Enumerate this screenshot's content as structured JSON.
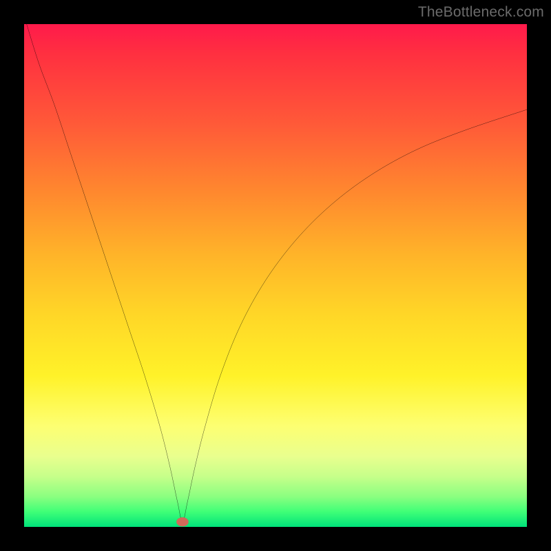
{
  "watermark": "TheBottleneck.com",
  "colors": {
    "frame": "#000000",
    "curve": "#000000",
    "marker_fill": "#d16a5a",
    "marker_stroke": "#b94f40",
    "gradient_stops": [
      "#ff1a4b",
      "#ff3040",
      "#ff5a38",
      "#ff8a2e",
      "#ffb429",
      "#ffd727",
      "#fff229",
      "#fdff72",
      "#e9ff8e",
      "#c6ff8a",
      "#8aff80",
      "#3fff77",
      "#00e27a"
    ]
  },
  "chart_data": {
    "type": "line",
    "title": "",
    "xlabel": "",
    "ylabel": "",
    "xlim": [
      0,
      100
    ],
    "ylim": [
      0,
      100
    ],
    "grid": false,
    "legend": false,
    "comment": "V-shaped bottleneck curve. x is horizontal position (0–100), y is vertical value where 0 = bottom (green) and 100 = top (red). Minimum at x≈31.5, y≈1.",
    "series": [
      {
        "name": "bottleneck-curve",
        "x": [
          0.5,
          3,
          6,
          9,
          12,
          15,
          18,
          21,
          24,
          27,
          29,
          30.5,
          31.5,
          32.5,
          34,
          36,
          39,
          43,
          48,
          54,
          61,
          69,
          78,
          88,
          100
        ],
        "y": [
          100,
          92,
          84,
          75,
          66,
          57,
          48,
          39,
          30,
          20,
          12,
          5,
          1,
          5,
          12,
          20,
          30,
          40,
          49,
          57,
          64,
          70,
          75,
          79,
          83
        ]
      }
    ],
    "marker": {
      "x": 31.5,
      "y": 1,
      "rx": 1.2,
      "ry": 0.9
    }
  }
}
